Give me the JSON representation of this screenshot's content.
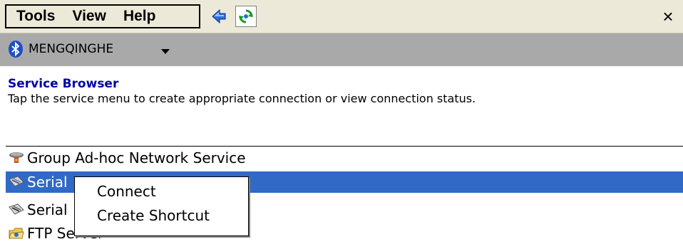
{
  "menubar": {
    "menus": [
      "Tools",
      "View",
      "Help"
    ],
    "back_icon": "blue-left-arrow-icon",
    "refresh_icon": "green-refresh-icon",
    "close_label": "×"
  },
  "device_bar": {
    "icon": "bluetooth-icon",
    "device_name": "MENGQINGHE"
  },
  "header": {
    "title": "Service Browser",
    "subtitle": "Tap the service menu to create appropriate connection or view connection status."
  },
  "services": [
    {
      "label": "Group Ad-hoc Network Service",
      "icon": "network-hub-icon",
      "selected": false
    },
    {
      "label": "Serial",
      "icon": "serial-port-icon",
      "selected": true
    },
    {
      "label": "Serial",
      "icon": "serial-port-icon",
      "selected": false
    },
    {
      "label": "FTP Server",
      "icon": "ftp-folder-icon",
      "selected": false
    }
  ],
  "context_menu": {
    "items": [
      "Connect",
      "Create Shortcut"
    ]
  }
}
